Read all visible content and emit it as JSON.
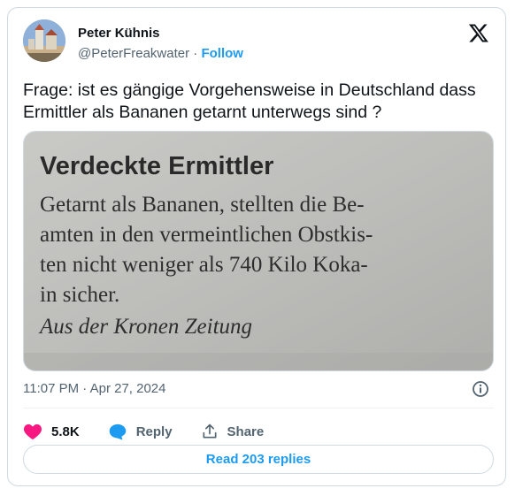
{
  "author": {
    "name": "Peter Kühnis",
    "handle": "@PeterFreakwater",
    "separator": "·",
    "follow_label": "Follow"
  },
  "tweet": {
    "text": "Frage:  ist es gängige Vorgehensweise in Deutschland dass Ermittler als Bananen getarnt unterwegs sind ?",
    "timestamp": "11:07 PM · Apr 27, 2024"
  },
  "media": {
    "headline": "Verdeckte Ermittler",
    "body_lines": [
      "Getarnt als Bananen, stellten die Be-",
      "amten in den vermeintlichen Obstkis-",
      "ten nicht weniger als 740 Kilo Koka-",
      "in sicher."
    ],
    "source": "Aus der Kronen Zeitung"
  },
  "actions": {
    "like_count": "5.8K",
    "reply_label": "Reply",
    "share_label": "Share"
  },
  "read_replies_label": "Read 203 replies",
  "colors": {
    "accent": "#1d9bf0",
    "like": "#f91880",
    "muted": "#536471",
    "border": "#cfd9de"
  },
  "icons": [
    "x-logo-icon",
    "info-icon",
    "heart-icon",
    "reply-bubble-icon",
    "share-icon"
  ]
}
